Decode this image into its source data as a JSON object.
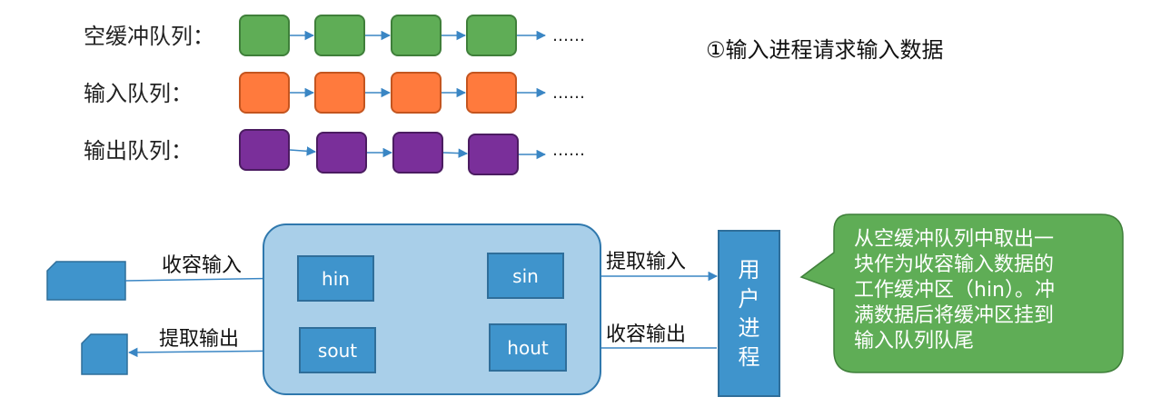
{
  "queues": [
    {
      "label": "空缓冲队列：",
      "color": "#5fad56",
      "dots": "……"
    },
    {
      "label": "输入队列：",
      "color": "#ff7a3d",
      "dots": "……"
    },
    {
      "label": "输出队列：",
      "color": "#7a2f9a",
      "dots": "……"
    }
  ],
  "step_title": "①输入进程请求输入数据",
  "buffers": {
    "hin": "hin",
    "sin": "sin",
    "sout": "sout",
    "hout": "hout"
  },
  "arrows": {
    "receive_input": "收容输入",
    "extract_output": "提取输出",
    "extract_input": "提取输入",
    "receive_output": "收容输出"
  },
  "user_process": [
    "用",
    "户",
    "进",
    "程"
  ],
  "callout": {
    "lines": [
      "从空缓冲队列中取出一",
      "块作为收容输入数据的",
      "工作缓冲区（hin）。冲",
      "满数据后将缓冲区挂到",
      "输入队列队尾"
    ],
    "color": "#5fad56"
  },
  "colors": {
    "panel": "#a9cfe9",
    "buffer": "#3f94cc",
    "arrow": "#3a86c4"
  }
}
